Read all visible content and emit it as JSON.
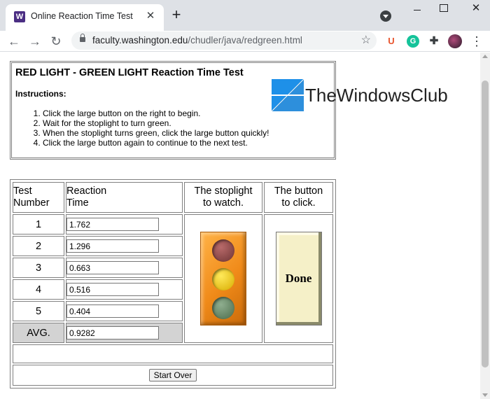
{
  "browser": {
    "tab_title": "Online Reaction Time Test",
    "favicon_letter": "W",
    "new_tab": "+",
    "url_host": "faculty.washington.edu",
    "url_path": "/chudler/java/redgreen.html",
    "extensions": {
      "u": "U",
      "g": "G"
    }
  },
  "page": {
    "title": "RED LIGHT - GREEN LIGHT Reaction Time Test",
    "instructions_label": "Instructions:",
    "instructions": [
      "Click the large button on the right to begin.",
      "Wait for the stoplight to turn green.",
      "When the stoplight turns green, click the large button quickly!",
      "Click the large button again to continue to the next test."
    ],
    "watermark": "TheWindowsClub",
    "table": {
      "header_test": [
        "Test",
        "Number"
      ],
      "header_reaction": [
        "Reaction",
        "Time"
      ],
      "header_stoplight": [
        "The stoplight",
        "to watch."
      ],
      "header_button": [
        "The button",
        "to click."
      ],
      "rows": [
        {
          "num": "1",
          "time": "1.762"
        },
        {
          "num": "2",
          "time": "1.296"
        },
        {
          "num": "3",
          "time": "0.663"
        },
        {
          "num": "4",
          "time": "0.516"
        },
        {
          "num": "5",
          "time": "0.404"
        }
      ],
      "avg_label": "AVG.",
      "avg_time": "0.9282",
      "click_button_label": "Done",
      "start_over_label": "Start Over"
    }
  },
  "colors": {
    "stoplight_body": "#f08a19",
    "click_button": "#f5f0c8",
    "avg_cell": "#d3d3d3",
    "favicon": "#4b2e83"
  }
}
